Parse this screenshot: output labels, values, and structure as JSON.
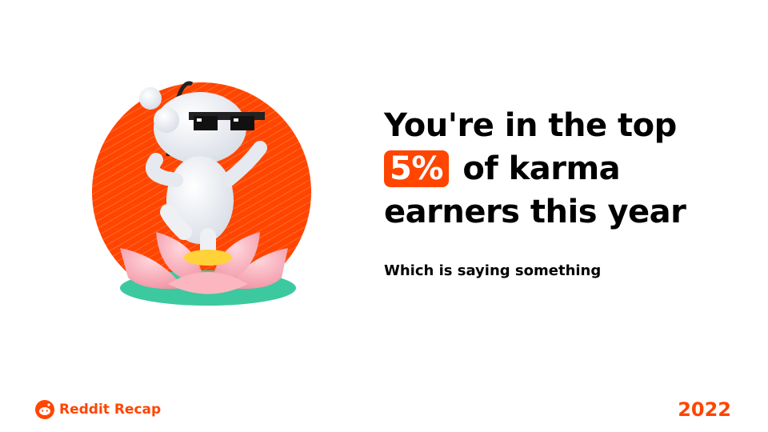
{
  "headline": {
    "line1": "You're in the top",
    "highlight": "5%",
    "line2_rest": "of karma",
    "line3": "earners this year"
  },
  "subtitle": "Which is saying something",
  "brand": {
    "label": "Reddit Recap",
    "icon": "reddit-snoo-icon"
  },
  "year": "2022",
  "colors": {
    "accent": "#FF4500",
    "text": "#000000",
    "background": "#FFFFFF"
  }
}
